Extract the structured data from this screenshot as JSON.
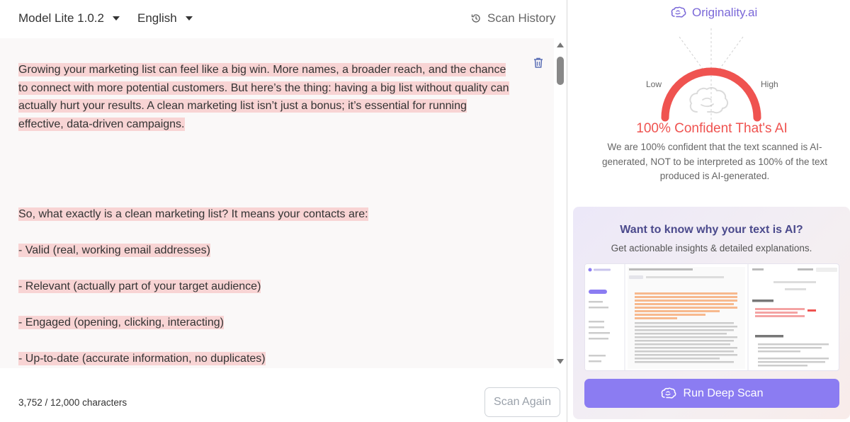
{
  "toolbar": {
    "model": "Model Lite 1.0.2",
    "language": "English",
    "history": "Scan History"
  },
  "editor": {
    "paragraph1": "Growing your marketing list can feel like a big win. More names, a broader reach, and the chance to connect with more potential customers. But here’s the thing: having a big list without quality can actually hurt your results. A clean marketing list isn’t just a bonus; it’s essential for running effective, data-driven campaigns.",
    "paragraph2": "So, what exactly is a clean marketing list? It means your contacts are:",
    "bullets": [
      "- Valid (real, working email addresses)",
      "- Relevant (actually part of your target audience)",
      "- Engaged (opening, clicking, interacting)",
      "- Up-to-date (accurate information, no duplicates)"
    ]
  },
  "footer": {
    "char_count": "3,752 / 12,000 characters",
    "scan_again": "Scan Again"
  },
  "result": {
    "brand": "Originality.ai",
    "gauge_low": "Low",
    "gauge_high": "High",
    "confidence_percent": 100,
    "headline": "100% Confident That's AI",
    "description": "We are 100% confident that the text scanned is AI-generated, NOT to be interpreted as 100% of the text produced is AI-generated."
  },
  "promo": {
    "title": "Want to know why your text is AI?",
    "subtitle": "Get actionable insights & detailed explanations.",
    "button": "Run Deep Scan"
  },
  "colors": {
    "highlight": "#f8d4d4",
    "gauge": "#ef5350",
    "accent": "#8b7cf2",
    "brand": "#7a68d8"
  }
}
